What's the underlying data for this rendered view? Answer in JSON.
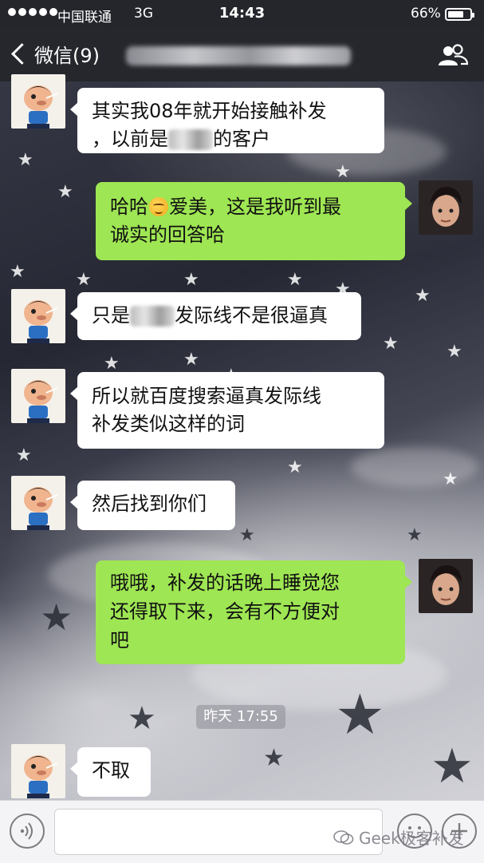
{
  "status_bar": {
    "carrier": "中国联通",
    "network": "3G",
    "time": "14:43",
    "battery": "66%",
    "battery_level": 0.66
  },
  "nav": {
    "back_label": "微信(9)",
    "icons": {
      "contacts": "group-contacts-icon",
      "back": "chevron-left-icon"
    }
  },
  "messages": [
    {
      "side": "in",
      "text_a": "其实我08年就开始接触补发",
      "text_b": "，以前是",
      "text_c": "的客户"
    },
    {
      "side": "out",
      "text_a": "哈哈",
      "text_b": "爱美，这是我听到最",
      "text_c": "诚实的回答哈"
    },
    {
      "side": "in",
      "text_a": "只是",
      "text_b": "发际线不是很逼真"
    },
    {
      "side": "in",
      "text_a": "所以就百度搜索逼真发际线",
      "text_b": "补发类似这样的词"
    },
    {
      "side": "in",
      "text_a": "然后找到你们"
    },
    {
      "side": "out",
      "text_a": "哦哦，补发的话晚上睡觉您",
      "text_b": "还得取下来，会有不方便对",
      "text_c": "吧"
    },
    {
      "side": "in",
      "text_a": "不取"
    }
  ],
  "timestamp": "昨天 17:55",
  "input": {
    "value": "",
    "icons": {
      "voice": "voice-icon",
      "emoji": "emoji-icon",
      "more": "plus-icon"
    }
  },
  "watermark": "Geek极客补发",
  "colors": {
    "bubble_out": "#9ee653",
    "bubble_in": "#ffffff",
    "nav_bg": "#25272d"
  }
}
